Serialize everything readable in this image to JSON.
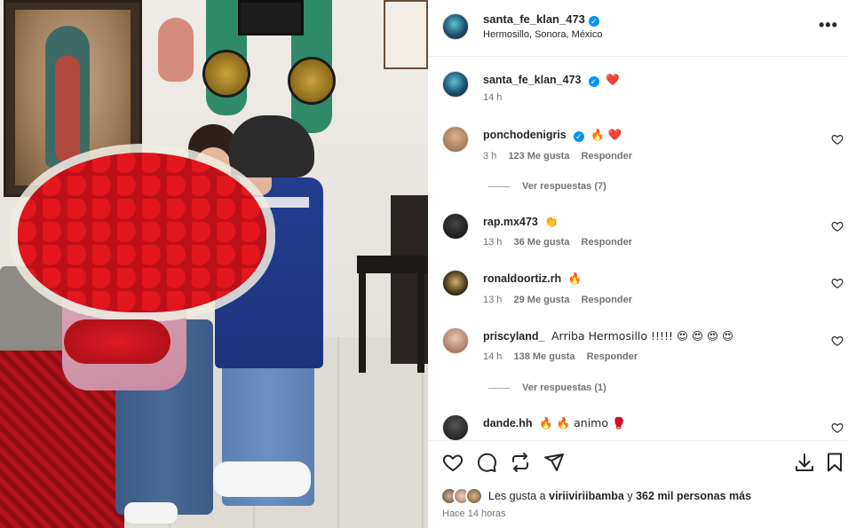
{
  "post": {
    "author": {
      "username": "santa_fe_klan_473",
      "verified": true,
      "location": "Hermosillo, Sonora, México"
    },
    "caption": {
      "username": "santa_fe_klan_473",
      "text": "❤️",
      "time": "14 h"
    }
  },
  "comments": [
    {
      "username": "ponchodenigris",
      "verified": true,
      "text": "🔥 ❤️",
      "time": "3 h",
      "likes": "123 Me gusta",
      "reply_label": "Responder",
      "view_replies": "Ver respuestas (7)"
    },
    {
      "username": "rap.mx473",
      "verified": false,
      "text": "👏",
      "time": "13 h",
      "likes": "36 Me gusta",
      "reply_label": "Responder"
    },
    {
      "username": "ronaldoortiz.rh",
      "verified": false,
      "text": "🔥",
      "time": "13 h",
      "likes": "29 Me gusta",
      "reply_label": "Responder"
    },
    {
      "username": "priscyland_",
      "verified": false,
      "text": "Arriba Hermosillo !!!!! 😍 😍 😍 😍",
      "time": "14 h",
      "likes": "138 Me gusta",
      "reply_label": "Responder",
      "view_replies": "Ver respuestas (1)"
    },
    {
      "username": "dande.hh",
      "verified": false,
      "text": "🔥 🔥 animo 🥊"
    }
  ],
  "actions": {
    "like_icon": "heart-icon",
    "comment_icon": "comment-icon",
    "repost_icon": "repost-icon",
    "share_icon": "send-icon",
    "download_icon": "download-icon",
    "save_icon": "bookmark-icon"
  },
  "likes_summary": {
    "prefix": "Les gusta a",
    "user": "viriiviriibamba",
    "middle": "y",
    "count": "362 mil personas más"
  },
  "post_time": "Hace 14 horas",
  "colors": {
    "verified": "#0095f6",
    "text": "#262626",
    "secondary": "#737373"
  }
}
